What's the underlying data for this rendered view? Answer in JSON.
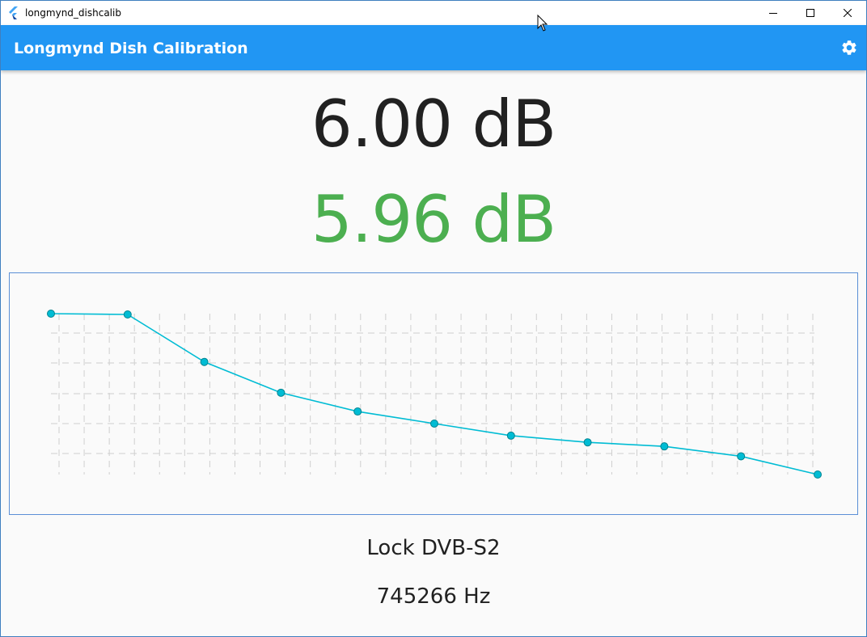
{
  "window": {
    "title": "longmynd_dishcalib",
    "app_icon": "flutter-logo-icon",
    "controls": [
      "minimize-icon",
      "maximize-icon",
      "close-icon"
    ]
  },
  "appbar": {
    "title": "Longmynd Dish Calibration",
    "settings_icon": "gear-icon",
    "color": "#2196f3"
  },
  "readings": {
    "primary": "6.00 dB",
    "secondary": "5.96 dB",
    "secondary_color": "#4caf50"
  },
  "chart_data": {
    "type": "line",
    "x": [
      0,
      1,
      2,
      3,
      4,
      5,
      6,
      7,
      8,
      9,
      10
    ],
    "series": [
      {
        "values": [
          6.0,
          5.97,
          4.2,
          3.05,
          2.35,
          1.9,
          1.45,
          1.2,
          1.05,
          0.68,
          0.0
        ],
        "color": "#00bcd4"
      }
    ],
    "grid": true,
    "ylim": [
      0,
      6
    ],
    "xlim": [
      0,
      10
    ]
  },
  "status": {
    "lock": "Lock DVB-S2",
    "frequency": "745266 Hz"
  }
}
